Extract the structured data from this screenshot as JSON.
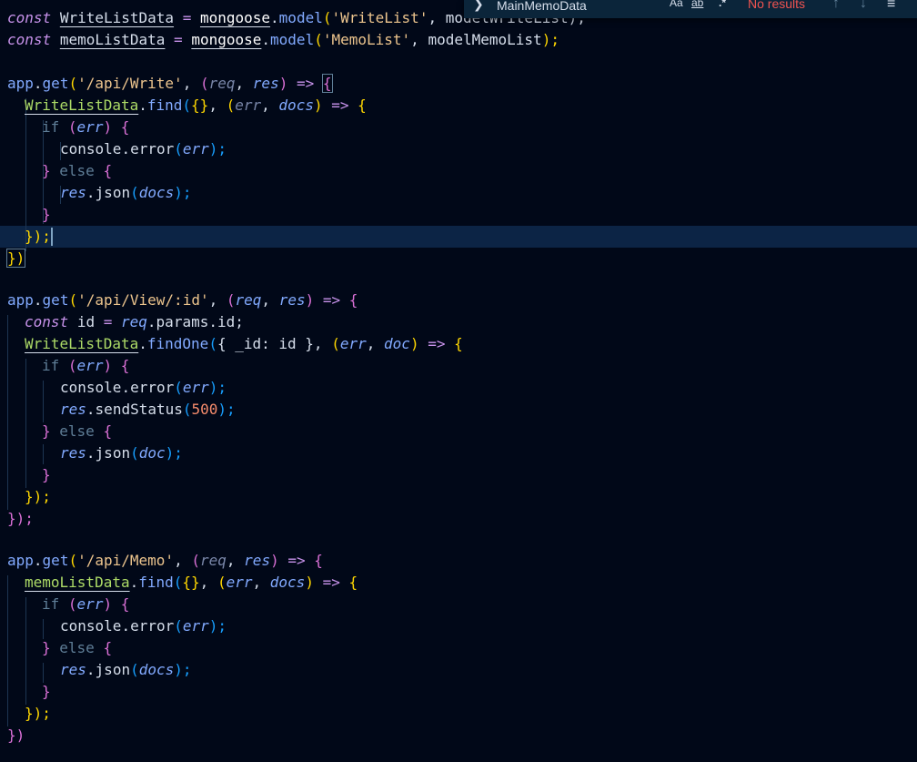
{
  "find_widget": {
    "search_value": "MainMemoData",
    "match_case_label": "Aa",
    "whole_word_label": "ab",
    "regex_label": ".*",
    "result_text": "No results",
    "prev_icon": "arrow-up-icon",
    "next_icon": "arrow-down-icon",
    "menu_icon": "menu-icon",
    "toggle_icon": "chevron-right-icon"
  },
  "code": {
    "l1": {
      "kw": "const",
      "name": "WriteListData",
      "eq": "=",
      "mongoose": "mongoose",
      "dot": ".",
      "fn": "model",
      "open": "(",
      "str": "'WriteList'",
      "comma": ",",
      "rest": "modelWriteList);"
    },
    "l2": {
      "kw": "const",
      "name": "memoListData",
      "eq": "=",
      "mongoose": "mongoose",
      "dot": ".",
      "fn": "model",
      "open": "(",
      "str": "'MemoList'",
      "comma": ",",
      "arg": "modelMemoList",
      "close": ");"
    },
    "l4": {
      "app": "app",
      "dot": ".",
      "fn": "get",
      "open": "(",
      "str": "'/api/Write'",
      "comma": ",",
      "popen": "(",
      "p1": "req",
      "c": ",",
      "p2": "res",
      "pclose": ")",
      "arrow": "=>",
      "brace": "{"
    },
    "l5": {
      "name": "WriteListData",
      "dot": ".",
      "fn": "find",
      "open": "(",
      "obj": "{}",
      "comma": ",",
      "popen": "(",
      "p1": "err",
      "c": ",",
      "p2": "docs",
      "pclose": ")",
      "arrow": "=>",
      "brace": "{"
    },
    "l6": {
      "kw": "if",
      "open": "(",
      "arg": "err",
      "close": ")",
      "brace": "{"
    },
    "l7": {
      "obj": "console",
      "dot": ".",
      "fn": "error",
      "open": "(",
      "arg": "err",
      "close": ");"
    },
    "l8": {
      "close": "}",
      "kw": "else",
      "open": "{"
    },
    "l9": {
      "obj": "res",
      "dot": ".",
      "fn": "json",
      "open": "(",
      "arg": "docs",
      "close": ");"
    },
    "l10": {
      "close": "}"
    },
    "l11": {
      "close": "});"
    },
    "l12": {
      "close": "})"
    },
    "l14": {
      "app": "app",
      "dot": ".",
      "fn": "get",
      "open": "(",
      "str": "'/api/View/:id'",
      "comma": ",",
      "popen": "(",
      "p1": "req",
      "c": ",",
      "p2": "res",
      "pclose": ")",
      "arrow": "=>",
      "brace": "{"
    },
    "l15": {
      "kw": "const",
      "name": "id",
      "eq": "=",
      "obj": "req",
      "dot": ".",
      "prop": "params",
      "dot2": ".",
      "prop2": "id",
      "semi": ";"
    },
    "l16": {
      "name": "WriteListData",
      "dot": ".",
      "fn": "findOne",
      "open": "(",
      "obj": "{ _id: id }",
      "comma": ",",
      "popen": "(",
      "p1": "err",
      "c": ",",
      "p2": "doc",
      "pclose": ")",
      "arrow": "=>",
      "brace": "{"
    },
    "l17": {
      "kw": "if",
      "open": "(",
      "arg": "err",
      "close": ")",
      "brace": "{"
    },
    "l18": {
      "obj": "console",
      "dot": ".",
      "fn": "error",
      "open": "(",
      "arg": "err",
      "close": ");"
    },
    "l19": {
      "obj": "res",
      "dot": ".",
      "fn": "sendStatus",
      "open": "(",
      "num": "500",
      "close": ");"
    },
    "l20": {
      "close": "}",
      "kw": "else",
      "open": "{"
    },
    "l21": {
      "obj": "res",
      "dot": ".",
      "fn": "json",
      "open": "(",
      "arg": "doc",
      "close": ");"
    },
    "l22": {
      "close": "}"
    },
    "l23": {
      "close": "});"
    },
    "l24": {
      "close": "});"
    },
    "l26": {
      "app": "app",
      "dot": ".",
      "fn": "get",
      "open": "(",
      "str": "'/api/Memo'",
      "comma": ",",
      "popen": "(",
      "p1": "req",
      "c": ",",
      "p2": "res",
      "pclose": ")",
      "arrow": "=>",
      "brace": "{"
    },
    "l27": {
      "name": "memoListData",
      "dot": ".",
      "fn": "find",
      "open": "(",
      "obj": "{}",
      "comma": ",",
      "popen": "(",
      "p1": "err",
      "c": ",",
      "p2": "docs",
      "pclose": ")",
      "arrow": "=>",
      "brace": "{"
    },
    "l28": {
      "kw": "if",
      "open": "(",
      "arg": "err",
      "close": ")",
      "brace": "{"
    },
    "l29": {
      "obj": "console",
      "dot": ".",
      "fn": "error",
      "open": "(",
      "arg": "err",
      "close": ");"
    },
    "l30": {
      "close": "}",
      "kw": "else",
      "open": "{"
    },
    "l31": {
      "obj": "res",
      "dot": ".",
      "fn": "json",
      "open": "(",
      "arg": "docs",
      "close": ");"
    },
    "l32": {
      "close": "}"
    },
    "l33": {
      "close": "});"
    },
    "l34": {
      "close": "})"
    }
  }
}
